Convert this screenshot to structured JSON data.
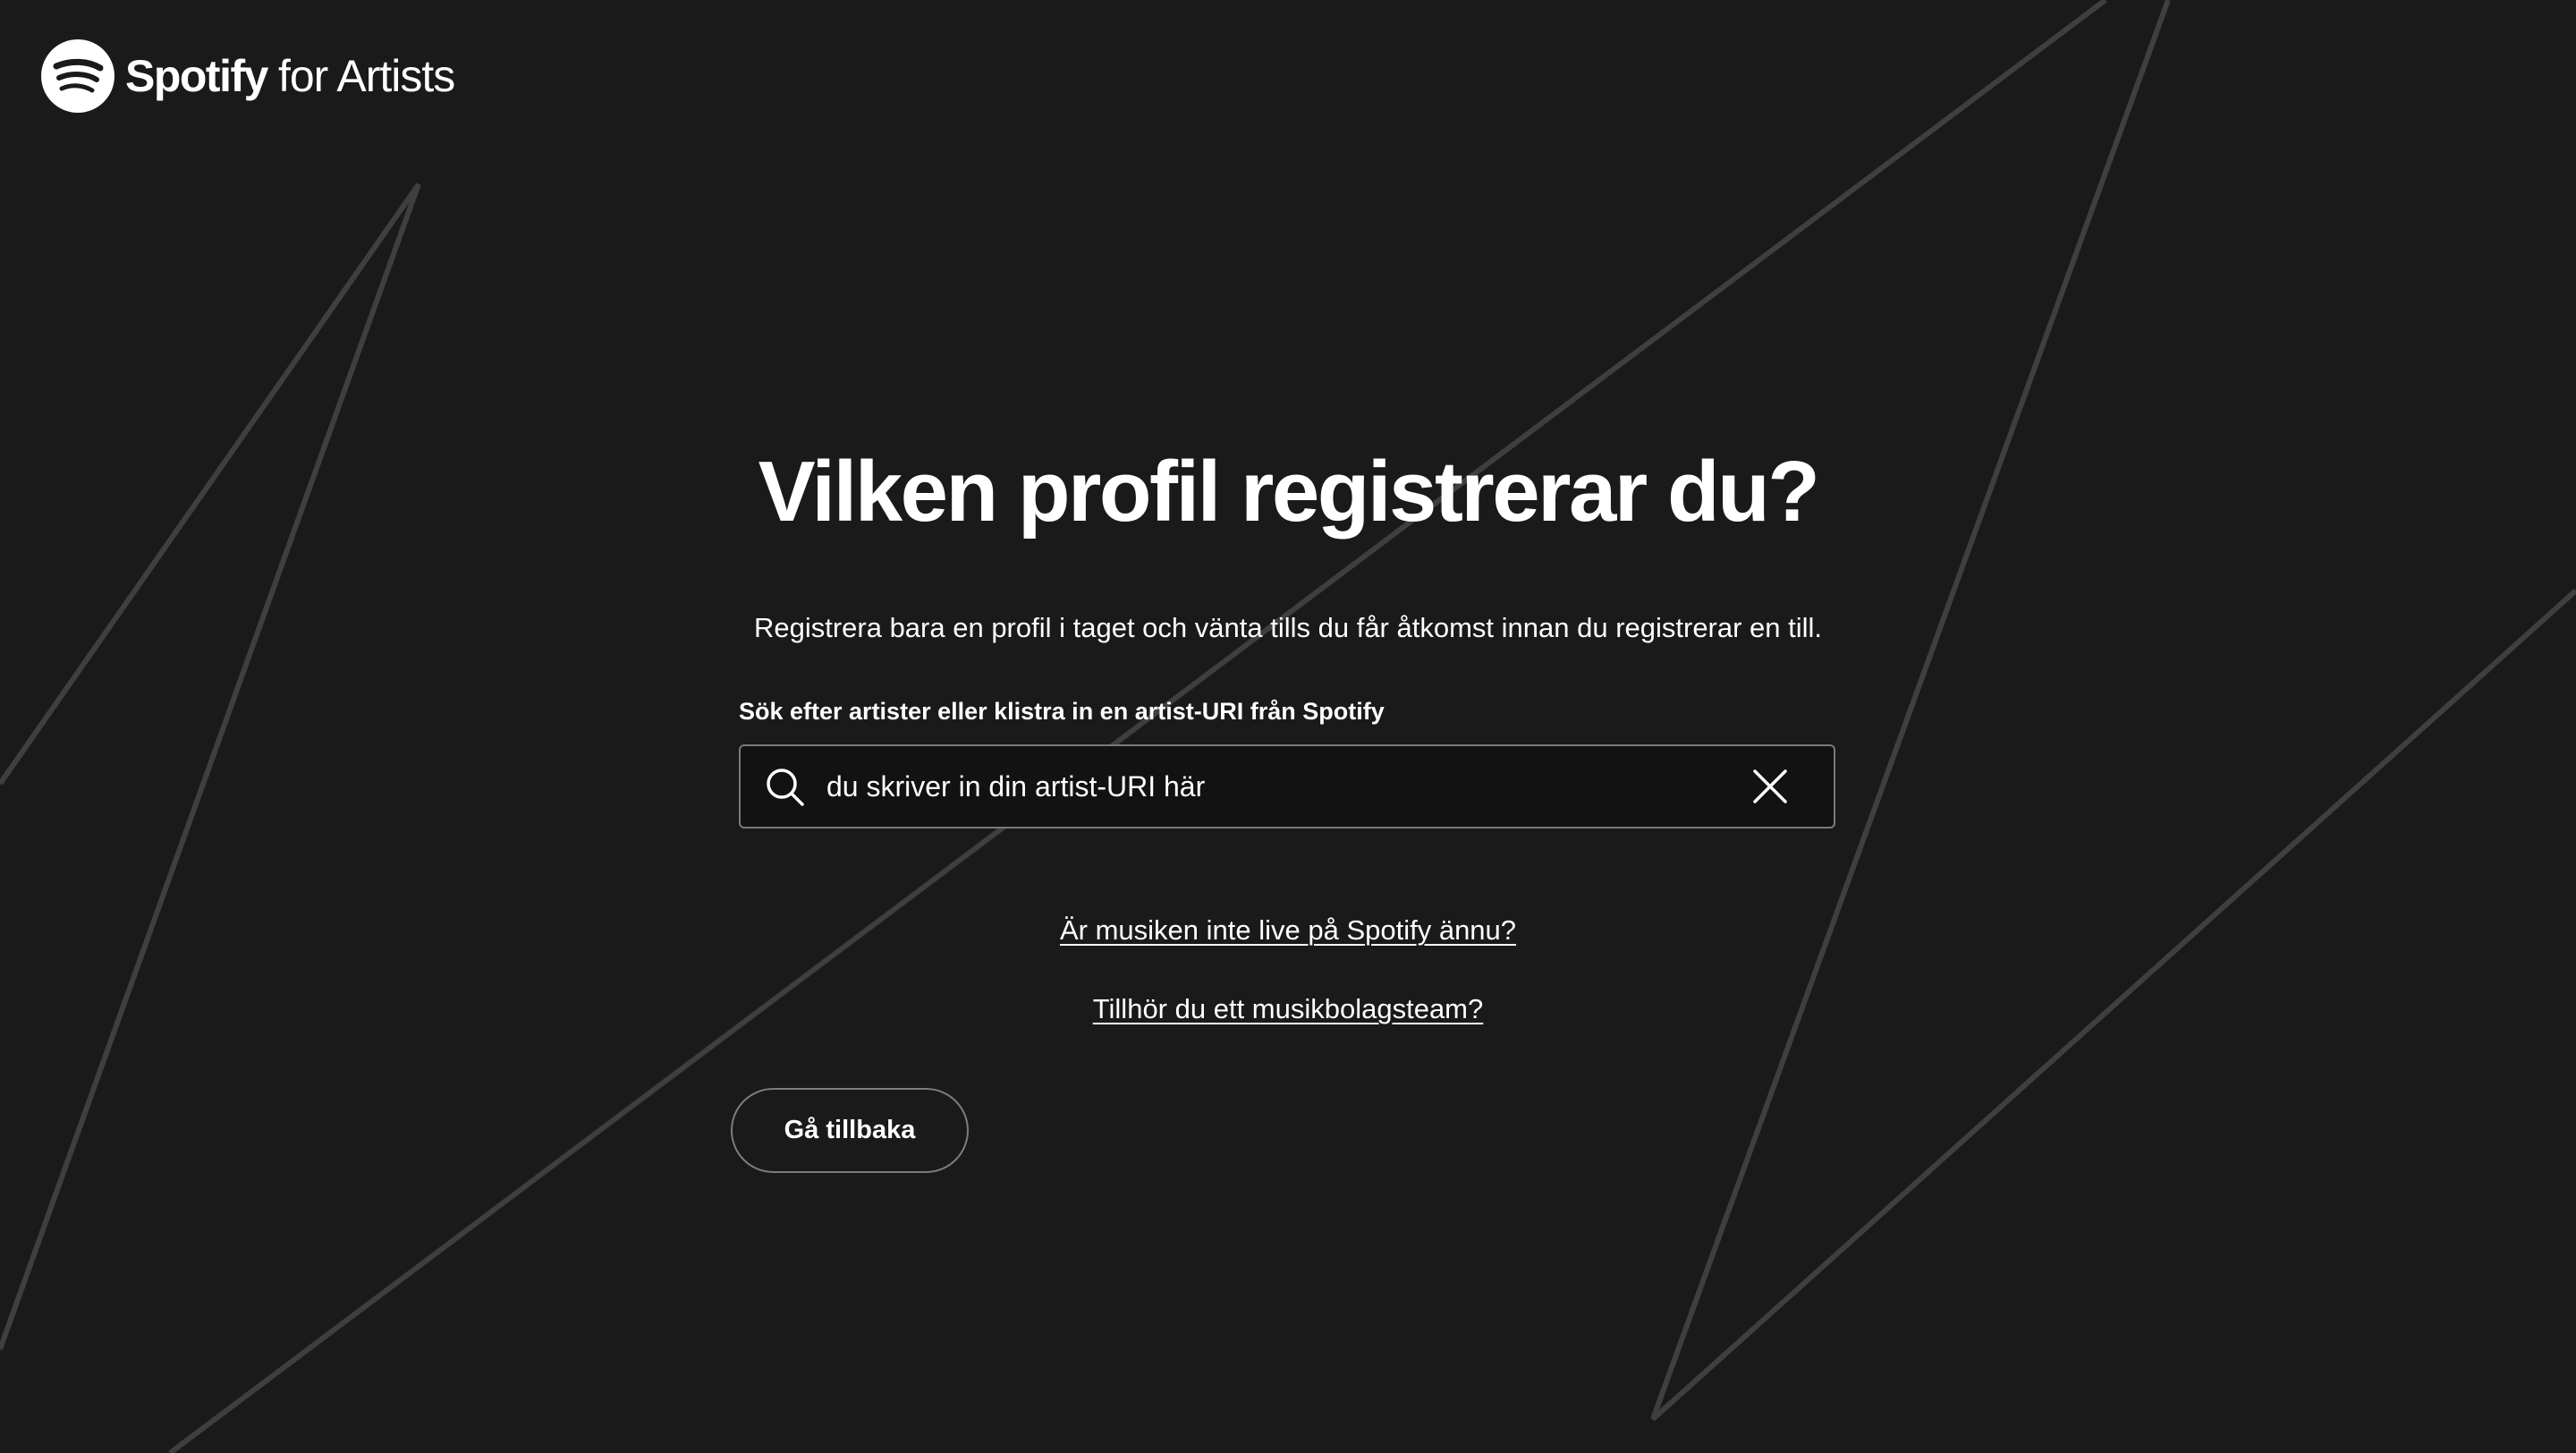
{
  "brand": {
    "name": "Spotify",
    "product": "for Artists"
  },
  "main": {
    "title": "Vilken profil registrerar du?",
    "subtitle": "Registrera bara en profil i taget och vänta tills du får åtkomst innan du registrerar en till.",
    "search": {
      "label": "Sök efter artister eller klistra in en artist-URI från Spotify",
      "value": "du skriver in din artist-URI här",
      "placeholder": ""
    },
    "links": {
      "not_live": "Är musiken inte live på Spotify ännu?",
      "label_team": "Tillhör du ett musikbolagsteam?"
    },
    "back_button": "Gå tillbaka"
  },
  "icons": {
    "logo": "spotify-logo-icon",
    "search": "search-icon",
    "clear": "close-icon"
  },
  "colors": {
    "background": "#1a1a1a",
    "text": "#ffffff",
    "decorative_lines": "#3f3f3f",
    "input_border": "#7a7a7a",
    "input_background": "#121212"
  }
}
